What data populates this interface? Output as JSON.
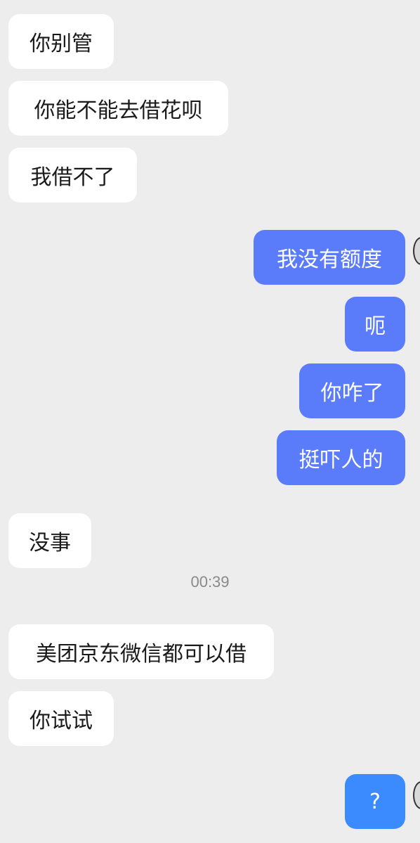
{
  "messages": [
    {
      "side": "in",
      "text": "你别管"
    },
    {
      "side": "in",
      "text": "你能不能去借花呗"
    },
    {
      "side": "in",
      "text": "我借不了"
    },
    {
      "side": "out",
      "text": "我没有额度"
    },
    {
      "side": "out",
      "text": "呃"
    },
    {
      "side": "out",
      "text": "你咋了"
    },
    {
      "side": "out",
      "text": "挺吓人的"
    },
    {
      "side": "in",
      "text": "没事"
    },
    {
      "side": "in",
      "text": "美团京东微信都可以借"
    },
    {
      "side": "in",
      "text": "你试试"
    },
    {
      "side": "out",
      "text": "?"
    }
  ],
  "timestamp": "00:39"
}
